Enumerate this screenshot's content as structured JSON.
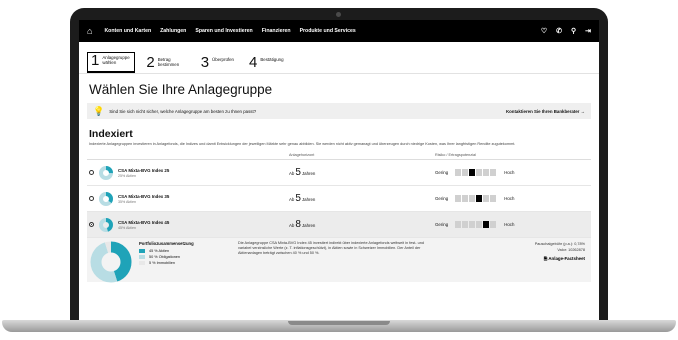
{
  "nav": {
    "items": [
      "Konten und Karten",
      "Zahlungen",
      "Sparen und Investieren",
      "Finanzieren",
      "Produkte und Services"
    ]
  },
  "stepper": [
    {
      "number": "1",
      "label": "Anlagegruppe wählen"
    },
    {
      "number": "2",
      "label": "Betrag bestimmen"
    },
    {
      "number": "3",
      "label": "Überprüfen"
    },
    {
      "number": "4",
      "label": "Bestätigung"
    }
  ],
  "page_title": "Wählen Sie Ihre Anlagegruppe",
  "hint": {
    "text": "Sind Sie sich nicht sicher, welche Anlagegruppe am besten zu Ihnen passt?",
    "link": "Kontaktieren Sie Ihren Bankberater →"
  },
  "section": {
    "title": "Indexiert",
    "description": "Indexierte Anlagegruppen investieren in Anlagefonds, die Indizes und damit Entwicklungen der jeweiligen Märkte sehr genau abbilden. Sie werden nicht aktiv gemanagt und überzeugen durch niedrige Kosten, was Ihrer langfristigen Rendite zugutekommt."
  },
  "table_headers": {
    "horizon": "Anlagehorizont",
    "risk": "Risiko / Ertragspotenzial"
  },
  "funds": [
    {
      "name": "CSA Mixta-BVG Index 25",
      "sub": "25% Aktien",
      "prefix": "Ab",
      "years": "5",
      "unit": "Jahren",
      "low": "Gering",
      "high": "Hoch",
      "equity": 0.25,
      "risk": 2
    },
    {
      "name": "CSA Mixta-BVG Index 35",
      "sub": "35% Aktien",
      "prefix": "Ab",
      "years": "5",
      "unit": "Jahren",
      "low": "Gering",
      "high": "Hoch",
      "equity": 0.35,
      "risk": 3
    },
    {
      "name": "CSA Mixta-BVG Index 45",
      "sub": "45% Aktien",
      "prefix": "Ab",
      "years": "8",
      "unit": "Jahren",
      "low": "Gering",
      "high": "Hoch",
      "equity": 0.45,
      "risk": 4
    }
  ],
  "selected_index": 2,
  "detail": {
    "title": "Portfoliozusammensetzung",
    "items": [
      {
        "label": "45 % Aktien",
        "color": "#1fa3b8",
        "share": 0.45
      },
      {
        "label": "50 % Obligationen",
        "color": "#b8dde4",
        "share": 0.5
      },
      {
        "label": "5 % Immobilien",
        "color": "#e8e8e8",
        "share": 0.05
      }
    ],
    "text": "Die Anlagegruppe CSA Mixta-BVG Index 45 investiert indirekt über indexierte Anlagefonds weltweit in fest- und variabel verzinsliche Werte (z. T. inflationsgeschützt), in Aktien sowie in Schweizer Immobilien. Der Anteil der Aktienanlagen beträgt zwischen 40 % und 50 %.",
    "fee": "Pauschalgebühr (p.a.): 0,78%",
    "valor": "Valor: 10262878",
    "factsheet": "Anlage-Factsheet"
  },
  "colors": {
    "accent": "#1fa3b8",
    "accent_light": "#b8dde4",
    "nav": "#000000"
  }
}
